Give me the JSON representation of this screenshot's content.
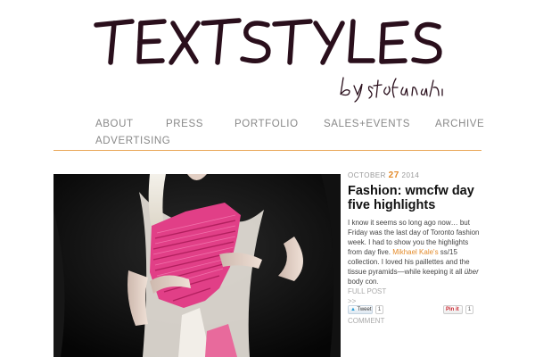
{
  "logo": {
    "title": "TEXTSTYLES",
    "byline": "by Stefania Yarhi"
  },
  "nav": {
    "items": [
      {
        "label": "ABOUT"
      },
      {
        "label": "PRESS"
      },
      {
        "label": "PORTFOLIO"
      },
      {
        "label": "SALES+EVENTS"
      },
      {
        "label": "ARCHIVE"
      },
      {
        "label": "ADVERTISING"
      }
    ]
  },
  "colors": {
    "accent": "#e38b2b",
    "rule": "#e9a758",
    "logo_ink": "#2a0f1c"
  },
  "post": {
    "date_month": "OCTOBER",
    "date_day": "27",
    "date_year": "2014",
    "title": "Fashion: wmcfw day five highlights",
    "excerpt_before": "I know it seems so long ago now… but Friday was the last day of Toronto fashion week. I had to show you the highlights from day five. ",
    "excerpt_link": "Mikhael Kale's",
    "excerpt_mid": " ss/15 collection. I loved his paillettes and the tissue pyramids—while keeping it all ",
    "excerpt_italic": "über",
    "excerpt_after": " body con.",
    "full_post": "FULL POST",
    "arrows": ">>",
    "tweet_label": "Tweet",
    "tweet_count": "1",
    "pin_label": "Pin it",
    "pin_count": "1",
    "comment": "COMMENT"
  }
}
